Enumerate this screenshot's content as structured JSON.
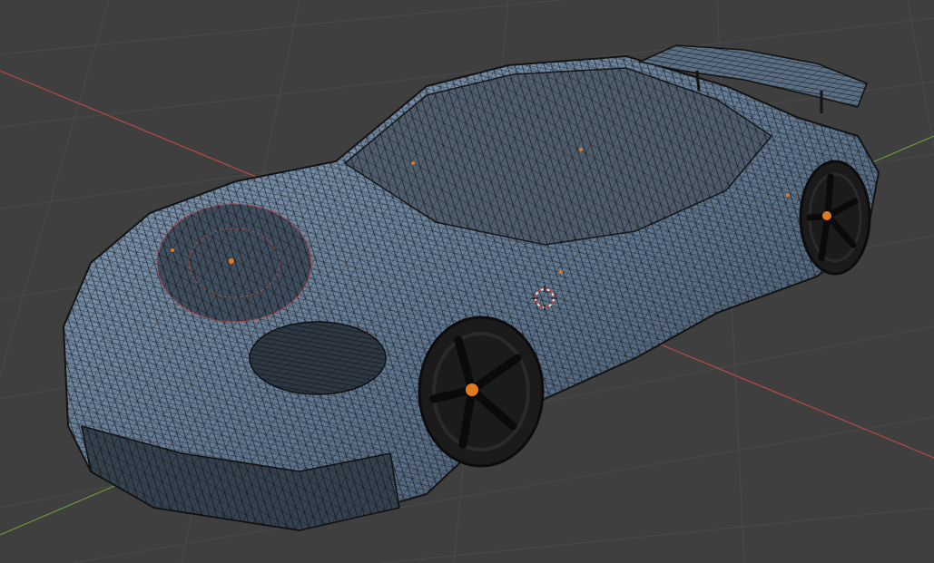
{
  "viewport": {
    "mode": "wireframe",
    "background_color": "#3f3f3f",
    "grid_color": "#4a4a4a",
    "x_axis_color": "#b84848",
    "y_axis_color": "#6a9a3a",
    "mesh_fill_color": "#6f8aa6",
    "wire_color": "#141414",
    "selected_color": "#e07a20",
    "tire_color": "#1b1b1b"
  },
  "scene": {
    "object": "car-model",
    "icons": {
      "cursor": "3d-cursor-icon",
      "origin": "object-origin-icon"
    }
  }
}
